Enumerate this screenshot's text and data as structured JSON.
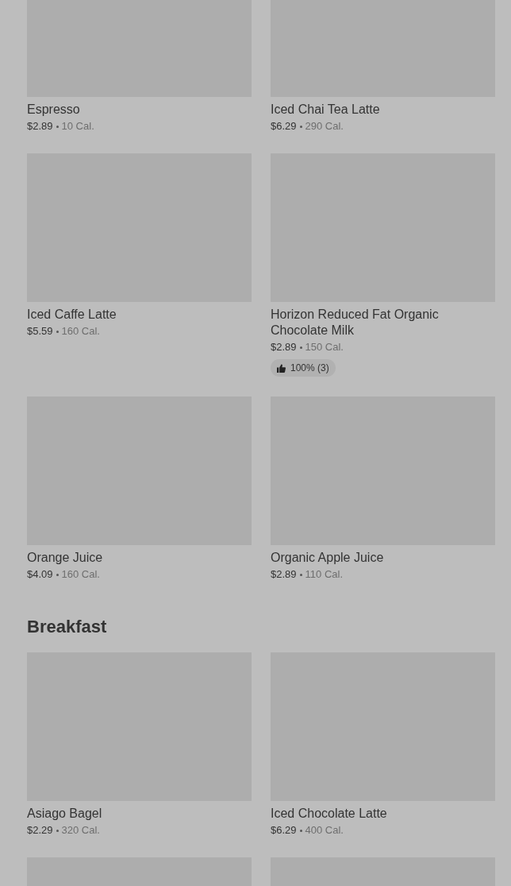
{
  "sections": [
    {
      "items": [
        {
          "kind": "product",
          "name": "Espresso",
          "price": "$2.89",
          "calories": "10 Cal."
        },
        {
          "kind": "product",
          "name": "Iced Chai Tea Latte",
          "price": "$6.29",
          "calories": "290 Cal."
        },
        {
          "kind": "product",
          "name": "Iced Caffe Latte",
          "price": "$5.59",
          "calories": "160 Cal."
        },
        {
          "kind": "product",
          "name": "Horizon Reduced Fat Organic Chocolate Milk",
          "price": "$2.89",
          "calories": "150 Cal.",
          "rating": "100% (3)"
        },
        {
          "kind": "product",
          "name": "Orange Juice",
          "price": "$4.09",
          "calories": "160 Cal."
        },
        {
          "kind": "product",
          "name": "Organic Apple Juice",
          "price": "$2.89",
          "calories": "110 Cal."
        }
      ]
    },
    {
      "title": "Breakfast",
      "items": [
        {
          "kind": "product",
          "name": "Asiago Bagel",
          "price": "$2.29",
          "calories": "320 Cal."
        },
        {
          "kind": "product",
          "name": "Iced Chocolate Latte",
          "price": "$6.29",
          "calories": "400 Cal."
        },
        {
          "kind": "picture"
        },
        {
          "kind": "picture"
        }
      ]
    }
  ]
}
